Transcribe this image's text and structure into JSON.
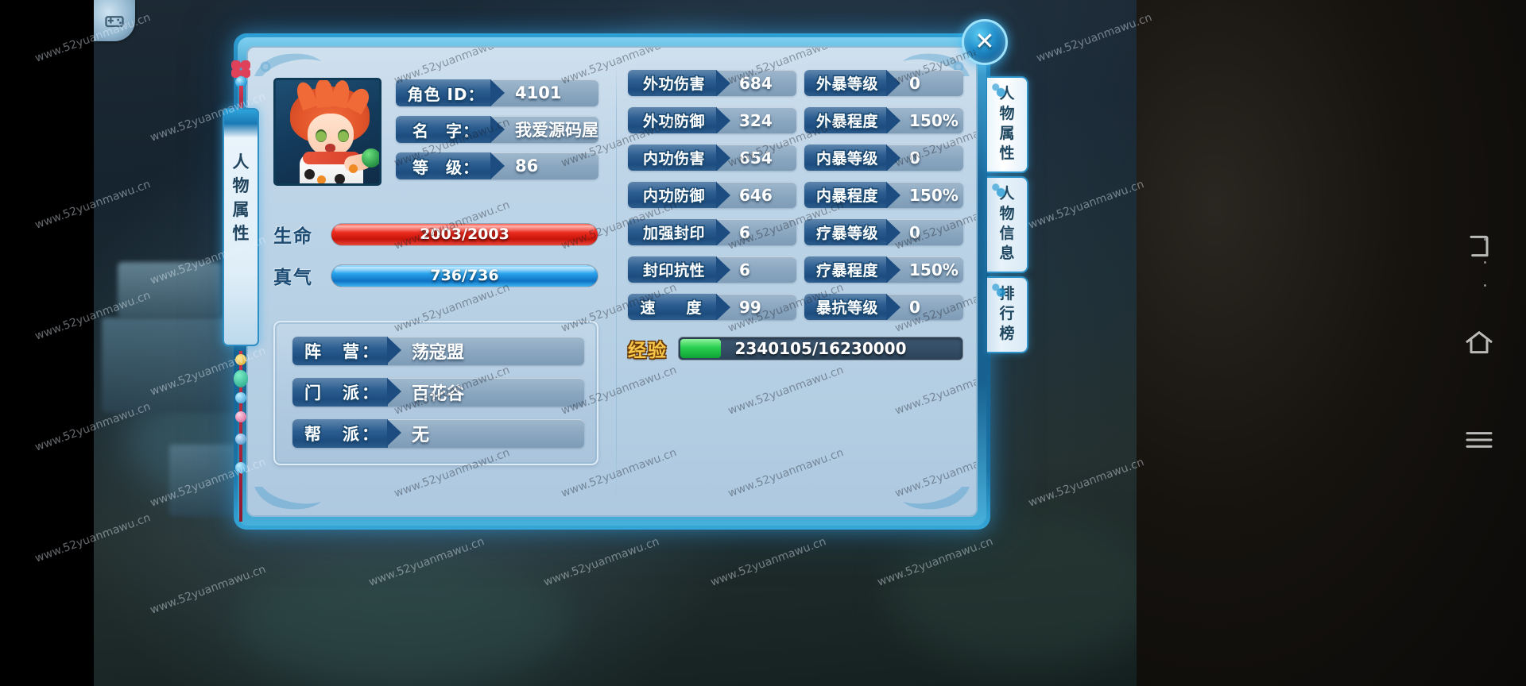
{
  "window": {
    "close_label": "✕",
    "game_icon": "gamepad-icon"
  },
  "tassel": {
    "chars": [
      "人",
      "物",
      "属",
      "性"
    ]
  },
  "side_tabs": [
    {
      "label": "人物属性",
      "chars": [
        "人",
        "物",
        "属",
        "性"
      ],
      "active": true
    },
    {
      "label": "人物信息",
      "chars": [
        "人",
        "物",
        "信",
        "息"
      ],
      "active": false
    },
    {
      "label": "排行榜",
      "chars": [
        "排",
        "行",
        "榜"
      ],
      "active": false
    }
  ],
  "character": {
    "portrait_alt": "character-avatar",
    "fields": [
      {
        "label": "角色 ID：",
        "value": "4101"
      },
      {
        "label": "名　字：",
        "value": "我爱源码屋"
      },
      {
        "label": "等　级：",
        "value": "86"
      }
    ]
  },
  "bars": [
    {
      "name": "生命",
      "value": "2003/2003",
      "percent": 100,
      "color": "#ee2c20",
      "kind": "hp"
    },
    {
      "name": "真气",
      "value": "736/736",
      "percent": 100,
      "color": "#2aa6ee",
      "kind": "mp"
    }
  ],
  "affiliation": {
    "fields": [
      {
        "label": "阵　营：",
        "value": "荡寇盟"
      },
      {
        "label": "门　派：",
        "value": "百花谷"
      },
      {
        "label": "帮　派：",
        "value": "无"
      }
    ]
  },
  "stats": [
    {
      "label": "外功伤害",
      "value": "684",
      "label2": "外暴等级",
      "value2": "0"
    },
    {
      "label": "外功防御",
      "value": "324",
      "label2": "外暴程度",
      "value2": "150%"
    },
    {
      "label": "内功伤害",
      "value": "654",
      "label2": "内暴等级",
      "value2": "0"
    },
    {
      "label": "内功防御",
      "value": "646",
      "label2": "内暴程度",
      "value2": "150%"
    },
    {
      "label": "加强封印",
      "value": "6",
      "label2": "疗暴等级",
      "value2": "0"
    },
    {
      "label": "封印抗性",
      "value": "6",
      "label2": "疗暴程度",
      "value2": "150%"
    },
    {
      "label": "速　度",
      "value": "99",
      "label2": "暴抗等级",
      "value2": "0"
    }
  ],
  "experience": {
    "label": "经验",
    "current": "2340105",
    "max": "16230000",
    "value": "2340105/16230000",
    "percent": 14.4,
    "color": "#28cf4f"
  },
  "colors": {
    "frame_glow": "#3caae6",
    "panel_bg": "#bed5e8",
    "label_blue": "#1d4d80",
    "hp_red": "#ee2c20",
    "mp_blue": "#2aa6ee",
    "exp_green": "#28cf4f",
    "exp_gold": "#f7c74a"
  },
  "watermark": {
    "text": "www.52yuanmawu.cn"
  },
  "system_nav": [
    {
      "name": "recent-apps-icon"
    },
    {
      "name": "home-icon"
    },
    {
      "name": "menu-icon"
    }
  ]
}
